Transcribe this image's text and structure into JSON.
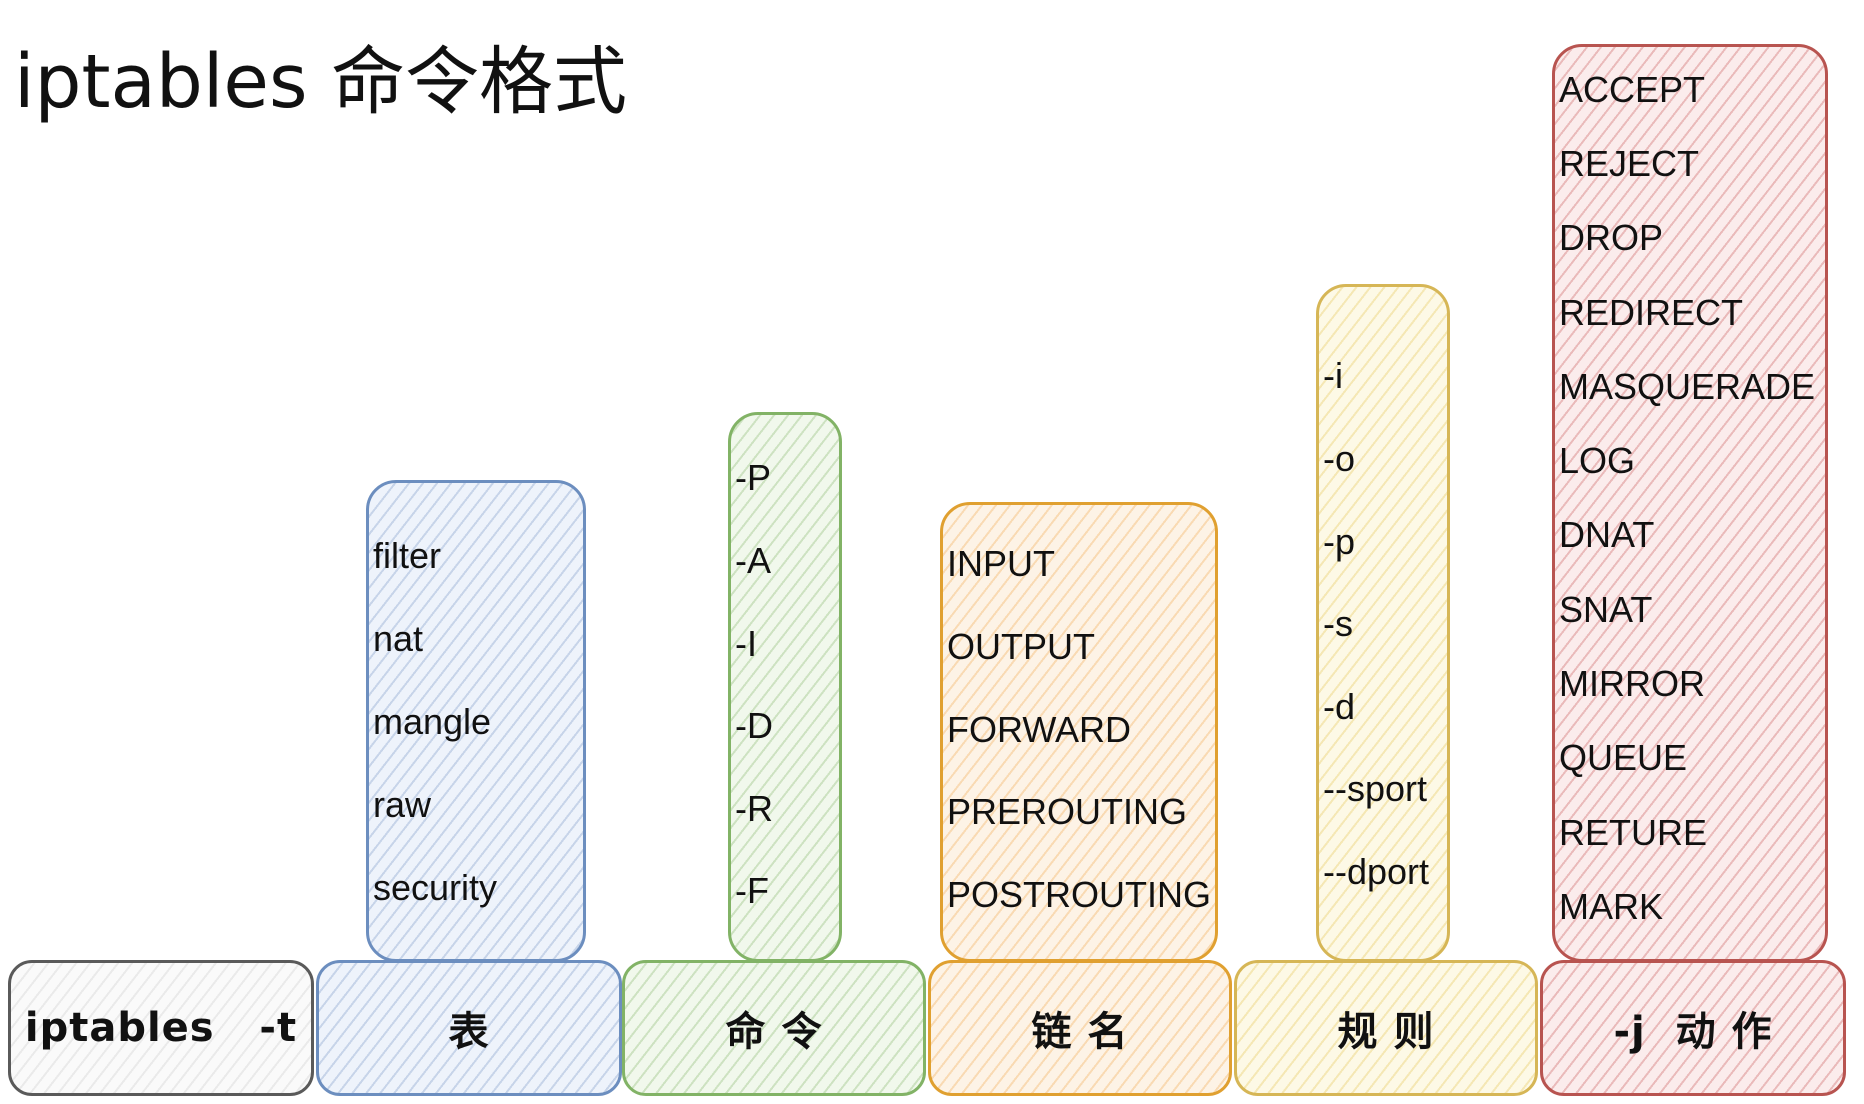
{
  "title": "iptables 命令格式",
  "base_labels": {
    "cmd": "iptables   -t",
    "table": "表",
    "command": "命 令",
    "chain": "链 名",
    "rule": "规 则",
    "action": "-j  动 作"
  },
  "tables": [
    "filter",
    "nat",
    "mangle",
    "raw",
    "security"
  ],
  "commands": [
    "-P",
    "-A",
    "-I",
    "-D",
    "-R",
    "-F"
  ],
  "chains": [
    "INPUT",
    "OUTPUT",
    "FORWARD",
    "PREROUTING",
    "POSTROUTING"
  ],
  "rules": [
    "-i",
    "-o",
    "-p",
    "-s",
    "-d",
    "--sport",
    "--dport"
  ],
  "actions": [
    "ACCEPT",
    "REJECT",
    "DROP",
    "REDIRECT",
    "MASQUERADE",
    "LOG",
    "DNAT",
    "SNAT",
    "MIRROR",
    "QUEUE",
    "RETURE",
    "MARK"
  ],
  "colors": {
    "gray": "#5a5a5a",
    "blue": "#6c8ebf",
    "green": "#82b366",
    "orange": "#e0a030",
    "yellow": "#d6b656",
    "red": "#b85450"
  }
}
